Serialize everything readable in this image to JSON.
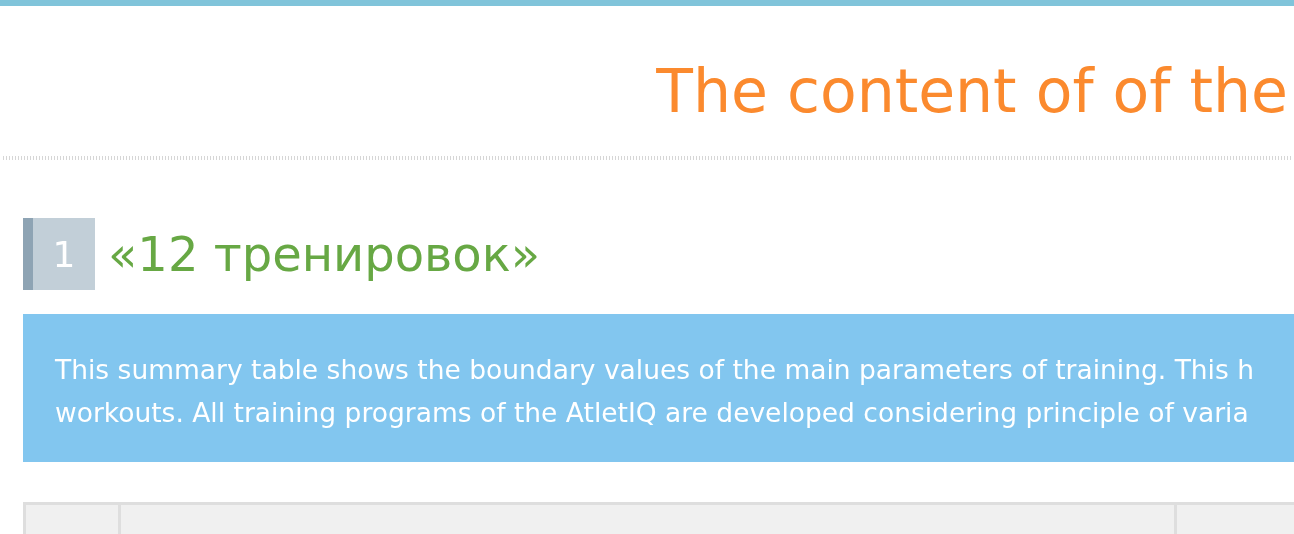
{
  "page_title": "The content of of the",
  "section": {
    "number": "1",
    "title": "«12 тренировок»"
  },
  "note_lines": [
    "This summary table shows the boundary values of the main parameters of training. This h",
    "workouts. All training programs of the AtletIQ are developed considering principle of varia"
  ]
}
